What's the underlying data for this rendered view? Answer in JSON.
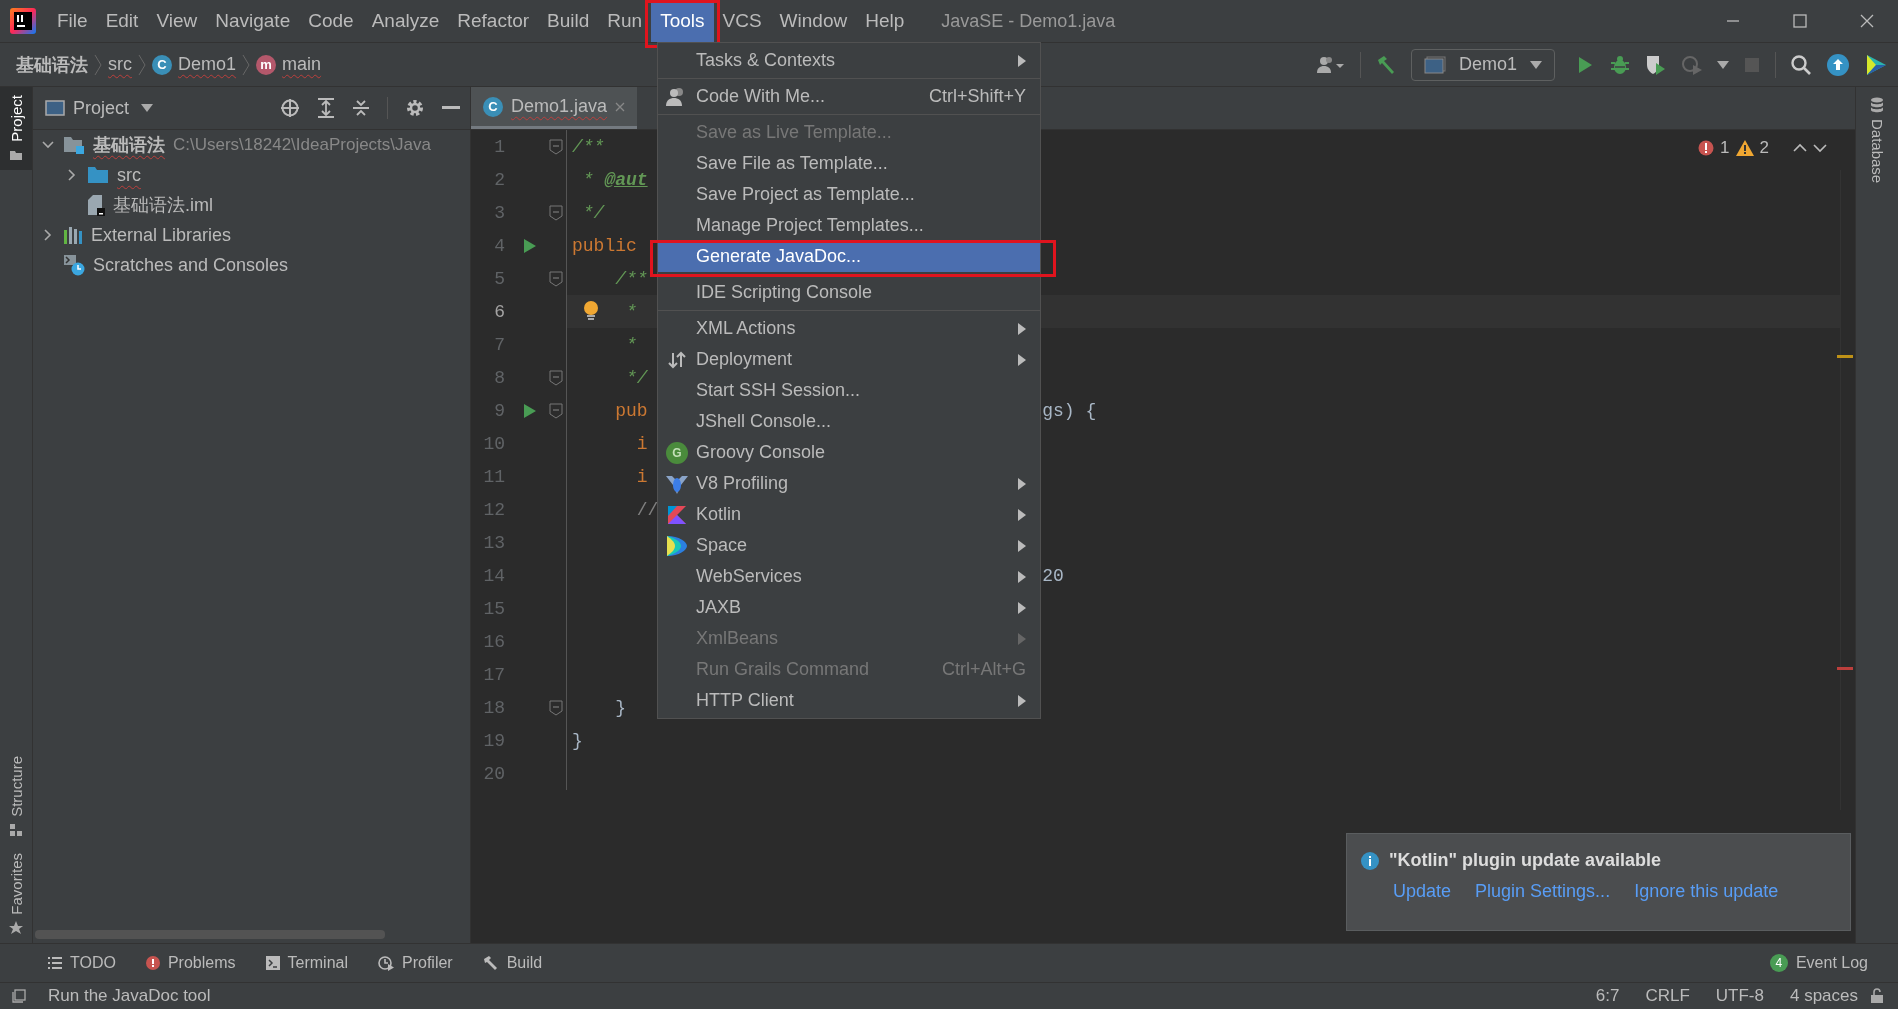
{
  "window": {
    "title": "JavaSE - Demo1.java"
  },
  "menu_bar": [
    {
      "label": "File",
      "selected": false
    },
    {
      "label": "Edit",
      "selected": false
    },
    {
      "label": "View",
      "selected": false
    },
    {
      "label": "Navigate",
      "selected": false
    },
    {
      "label": "Code",
      "selected": false
    },
    {
      "label": "Analyze",
      "selected": false
    },
    {
      "label": "Refactor",
      "selected": false
    },
    {
      "label": "Build",
      "selected": false
    },
    {
      "label": "Run",
      "selected": false
    },
    {
      "label": "Tools",
      "selected": true
    },
    {
      "label": "VCS",
      "selected": false
    },
    {
      "label": "Window",
      "selected": false
    },
    {
      "label": "Help",
      "selected": false
    }
  ],
  "breadcrumbs": [
    {
      "label": "基础语法",
      "kind": "module"
    },
    {
      "label": "src",
      "kind": "folder"
    },
    {
      "label": "Demo1",
      "kind": "class",
      "badge": "C"
    },
    {
      "label": "main",
      "kind": "method",
      "badge": "m"
    }
  ],
  "toolbar": {
    "run_config": "Demo1"
  },
  "left_stripe": [
    {
      "label": "Project",
      "selected": true
    },
    {
      "label": "Structure",
      "selected": false
    },
    {
      "label": "Favorites",
      "selected": false
    }
  ],
  "right_stripe": [
    {
      "label": "Database"
    }
  ],
  "project_panel": {
    "title": "Project",
    "tree": [
      {
        "label": "基础语法",
        "path": "C:\\Users\\18242\\IdeaProjects\\Java",
        "kind": "module",
        "expanded": true,
        "children": [
          {
            "label": "src",
            "kind": "folder",
            "expanded": false
          },
          {
            "label": "基础语法.iml",
            "kind": "file"
          }
        ]
      },
      {
        "label": "External Libraries",
        "kind": "libraries",
        "expanded": false
      },
      {
        "label": "Scratches and Consoles",
        "kind": "scratches"
      }
    ]
  },
  "editor": {
    "tab": {
      "label": "Demo1.java",
      "badge": "C"
    },
    "errors": "1",
    "warnings": "2",
    "lines": [
      {
        "number": "1",
        "runnable": false,
        "foldable": true,
        "intention": false,
        "current": false,
        "segments": [
          {
            "text": "/**",
            "kind": "doc"
          }
        ]
      },
      {
        "number": "2",
        "runnable": false,
        "foldable": false,
        "intention": false,
        "current": false,
        "segments": [
          {
            "text": " * ",
            "kind": "doc"
          },
          {
            "text": "@aut",
            "kind": "tag"
          }
        ]
      },
      {
        "number": "3",
        "runnable": false,
        "foldable": true,
        "intention": false,
        "current": false,
        "segments": [
          {
            "text": " */",
            "kind": "doc"
          }
        ]
      },
      {
        "number": "4",
        "runnable": true,
        "foldable": false,
        "intention": false,
        "current": false,
        "segments": [
          {
            "text": "public",
            "kind": "keyword"
          }
        ]
      },
      {
        "number": "5",
        "runnable": false,
        "foldable": true,
        "intention": false,
        "current": false,
        "segments": [
          {
            "text": "    /**",
            "kind": "doc"
          }
        ]
      },
      {
        "number": "6",
        "runnable": false,
        "foldable": false,
        "intention": true,
        "current": true,
        "segments": [
          {
            "text": "     *",
            "kind": "doc"
          }
        ]
      },
      {
        "number": "7",
        "runnable": false,
        "foldable": false,
        "intention": false,
        "current": false,
        "segments": [
          {
            "text": "     *",
            "kind": "doc"
          }
        ]
      },
      {
        "number": "8",
        "runnable": false,
        "foldable": true,
        "intention": false,
        "current": false,
        "segments": [
          {
            "text": "     */",
            "kind": "doc"
          }
        ]
      },
      {
        "number": "9",
        "runnable": true,
        "foldable": true,
        "intention": false,
        "current": false,
        "segments": [
          {
            "text": "    pub",
            "kind": "keyword"
          }
        ],
        "tail": "gs) {"
      },
      {
        "number": "10",
        "runnable": false,
        "foldable": false,
        "intention": false,
        "current": false,
        "segments": [
          {
            "text": "      i",
            "kind": "keyword"
          }
        ]
      },
      {
        "number": "11",
        "runnable": false,
        "foldable": false,
        "intention": false,
        "current": false,
        "segments": [
          {
            "text": "      i",
            "kind": "keyword"
          }
        ]
      },
      {
        "number": "12",
        "runnable": false,
        "foldable": false,
        "intention": false,
        "current": false,
        "segments": [
          {
            "text": "      //",
            "kind": "comment"
          }
        ]
      },
      {
        "number": "13",
        "runnable": false,
        "foldable": false,
        "intention": false,
        "current": false
      },
      {
        "number": "14",
        "runnable": false,
        "foldable": false,
        "intention": false,
        "current": false,
        "tail": "20"
      },
      {
        "number": "15",
        "runnable": false,
        "foldable": false,
        "intention": false,
        "current": false
      },
      {
        "number": "16",
        "runnable": false,
        "foldable": false,
        "intention": false,
        "current": false
      },
      {
        "number": "17",
        "runnable": false,
        "foldable": false,
        "intention": false,
        "current": false
      },
      {
        "number": "18",
        "runnable": false,
        "foldable": true,
        "intention": false,
        "current": false,
        "segments": [
          {
            "text": "    }",
            "kind": "plain"
          }
        ]
      },
      {
        "number": "19",
        "runnable": false,
        "foldable": false,
        "intention": false,
        "current": false,
        "segments": [
          {
            "text": "}",
            "kind": "plain"
          }
        ]
      },
      {
        "number": "20",
        "runnable": false,
        "foldable": false,
        "intention": false,
        "current": false
      }
    ]
  },
  "menu": {
    "groups": [
      [
        {
          "label": "Tasks & Contexts",
          "submenu": true,
          "disabled": false,
          "selected": false
        }
      ],
      [
        {
          "label": "Code With Me...",
          "shortcut": "Ctrl+Shift+Y",
          "kind": "people",
          "submenu": false,
          "disabled": false,
          "selected": false
        }
      ],
      [
        {
          "label": "Save as Live Template...",
          "submenu": false,
          "disabled": true,
          "selected": false
        },
        {
          "label": "Save File as Template...",
          "submenu": false,
          "disabled": false,
          "selected": false
        },
        {
          "label": "Save Project as Template...",
          "submenu": false,
          "disabled": false,
          "selected": false
        },
        {
          "label": "Manage Project Templates...",
          "submenu": false,
          "disabled": false,
          "selected": false
        },
        {
          "label": "Generate JavaDoc...",
          "submenu": false,
          "disabled": false,
          "selected": true
        }
      ],
      [
        {
          "label": "IDE Scripting Console",
          "submenu": false,
          "disabled": false,
          "selected": false
        }
      ],
      [
        {
          "label": "XML Actions",
          "submenu": true,
          "disabled": false,
          "selected": false
        },
        {
          "label": "Deployment",
          "kind": "deploy",
          "submenu": true,
          "disabled": false,
          "selected": false
        },
        {
          "label": "Start SSH Session...",
          "submenu": false,
          "disabled": false,
          "selected": false
        },
        {
          "label": "JShell Console...",
          "submenu": false,
          "disabled": false,
          "selected": false
        },
        {
          "label": "Groovy Console",
          "kind": "groovy",
          "badge": "G",
          "submenu": false,
          "disabled": false,
          "selected": false
        },
        {
          "label": "V8 Profiling",
          "kind": "v8",
          "submenu": true,
          "disabled": false,
          "selected": false
        },
        {
          "label": "Kotlin",
          "kind": "kotlin",
          "submenu": true,
          "disabled": false,
          "selected": false
        },
        {
          "label": "Space",
          "kind": "space",
          "submenu": true,
          "disabled": false,
          "selected": false
        },
        {
          "label": "WebServices",
          "submenu": true,
          "disabled": false,
          "selected": false
        },
        {
          "label": "JAXB",
          "submenu": true,
          "disabled": false,
          "selected": false
        },
        {
          "label": "XmlBeans",
          "submenu": true,
          "disabled": true,
          "selected": false
        },
        {
          "label": "Run Grails Command",
          "shortcut": "Ctrl+Alt+G",
          "submenu": false,
          "disabled": true,
          "selected": false
        },
        {
          "label": "HTTP Client",
          "submenu": true,
          "disabled": false,
          "selected": false
        }
      ]
    ]
  },
  "notification": {
    "title": "\"Kotlin\" plugin update available",
    "actions": [
      "Update",
      "Plugin Settings...",
      "Ignore this update"
    ]
  },
  "tool_windows": [
    {
      "label": "TODO",
      "kind": "list"
    },
    {
      "label": "Problems",
      "kind": "problems"
    },
    {
      "label": "Terminal",
      "kind": "terminal"
    },
    {
      "label": "Profiler",
      "kind": "profiler"
    },
    {
      "label": "Build",
      "kind": "hammer"
    }
  ],
  "event_log": {
    "label": "Event Log",
    "count": "4"
  },
  "status_bar": {
    "message": "Run the JavaDoc tool",
    "items": [
      "6:7",
      "CRLF",
      "UTF-8",
      "4 spaces"
    ]
  }
}
